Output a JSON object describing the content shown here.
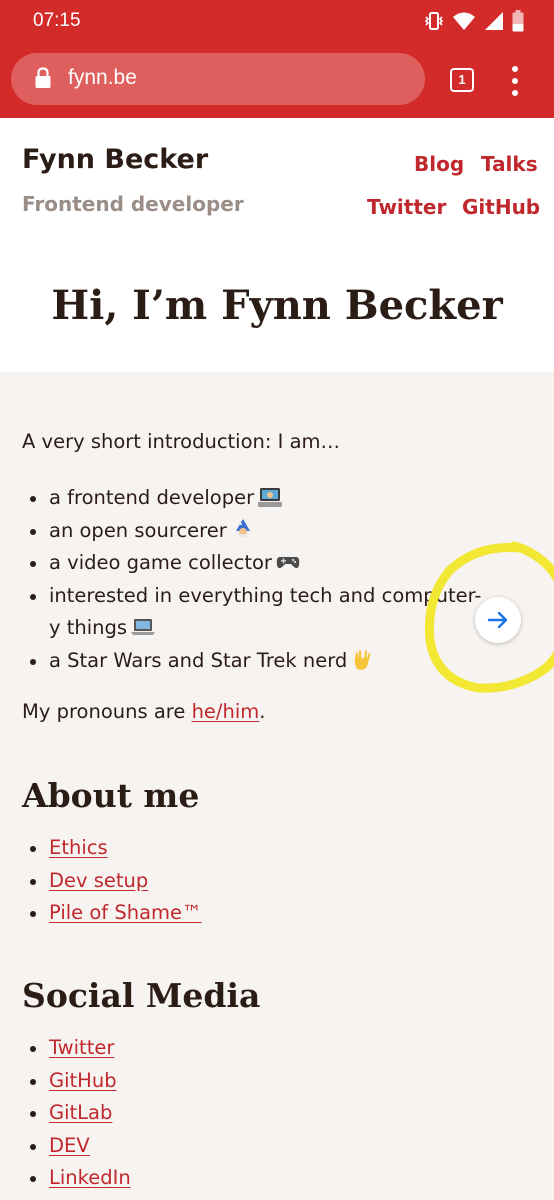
{
  "status_bar": {
    "time": "07:15"
  },
  "browser": {
    "url": "fynn.be",
    "tab_count": "1"
  },
  "header": {
    "name": "Fynn Becker",
    "subtitle": "Frontend developer",
    "nav": [
      "Blog",
      "Talks",
      "Twitter",
      "GitHub"
    ],
    "hero": "Hi, I’m Fynn Becker"
  },
  "intro": {
    "text": "A very short introduction: I am…",
    "items": [
      {
        "text": "a frontend developer",
        "icon": "technologist-emoji"
      },
      {
        "text": "an open sourcerer",
        "icon": "mage-emoji"
      },
      {
        "text": "a video game collector",
        "icon": "video-game-emoji"
      },
      {
        "text": "interested in everything tech and computer-y things",
        "icon": "laptop-emoji"
      },
      {
        "text": "a Star Wars and Star Trek nerd",
        "icon": "vulcan-salute-emoji"
      }
    ],
    "pronouns_prefix": "My pronouns are ",
    "pronouns_link": "he/him",
    "pronouns_suffix": "."
  },
  "about": {
    "title": "About me",
    "links": [
      "Ethics",
      "Dev setup",
      "Pile of Shame™"
    ]
  },
  "social": {
    "title": "Social Media",
    "links": [
      "Twitter",
      "GitHub",
      "GitLab",
      "DEV",
      "LinkedIn"
    ]
  },
  "colors": {
    "brand_red": "#d32a2a",
    "link_red": "#c0282d",
    "annotation_yellow": "#f2e733",
    "background": "#f7f3f0"
  }
}
